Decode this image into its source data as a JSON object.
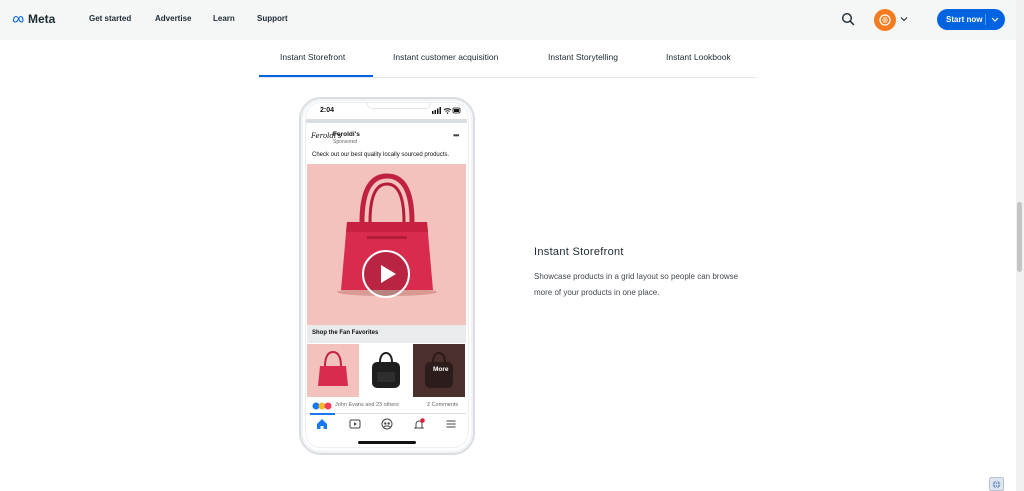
{
  "header": {
    "logo_text": "Meta",
    "nav": [
      "Get started",
      "Advertise",
      "Learn",
      "Support"
    ],
    "start_button": "Start now",
    "brand_color": "#0064e0"
  },
  "tabs": {
    "items": [
      "Instant Storefront",
      "Instant customer acquisition",
      "Instant Storytelling",
      "Instant Lookbook"
    ],
    "selected": "Instant Storefront"
  },
  "phone": {
    "time": "2:04",
    "brand_logo": "Feroldi's",
    "brand_name": "Feroldi's",
    "sponsored": "Sponsored ·",
    "post_text": "Check out our best quality locally sourced products.",
    "shop_label": "Shop the Fan Favorites",
    "more_label": "More",
    "reactions_text": "John Evans and 23 others",
    "comments_text": "2 Comments",
    "notification_count": "1"
  },
  "content": {
    "title": "Instant Storefront",
    "description": "Showcase products in a grid layout so people can browse more of your products in one place."
  }
}
